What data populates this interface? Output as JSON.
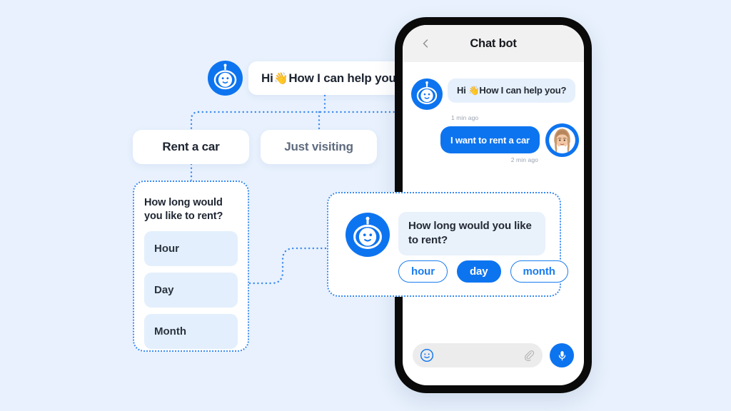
{
  "theme": {
    "background": "#e8f1fd",
    "accent_blue": "#0d74f0",
    "dotted_line": "#3b8af0",
    "bubble_light": "#e6f0fc",
    "panel_item": "#e3effc",
    "phone_frame": "#0a0a0a",
    "header_bg": "#f1f1f1",
    "muted_text": "#9aa3b0"
  },
  "flow": {
    "bot_icon": "chat-bot-icon",
    "greeting": {
      "prefix": "Hi ",
      "emoji": "👋",
      "text": "How I can help you?"
    },
    "options": [
      {
        "label": "Rent a car",
        "state": "selected"
      },
      {
        "label": "Just visiting",
        "state": "default"
      }
    ],
    "rent_panel": {
      "title": "How long would you like to rent?",
      "items": [
        "Hour",
        "Day",
        "Month"
      ]
    },
    "answer_card": {
      "bot_icon": "chat-bot-icon",
      "question": "How long would you like to rent?",
      "chips": [
        {
          "label": "hour",
          "style": "outline"
        },
        {
          "label": "day",
          "style": "filled"
        },
        {
          "label": "month",
          "style": "outline"
        }
      ]
    }
  },
  "phone": {
    "header": {
      "back_icon": "chevron-left-icon",
      "title": "Chat bot"
    },
    "messages": [
      {
        "sender": "bot",
        "avatar": "chat-bot-icon",
        "prefix": "Hi ",
        "emoji": "👋",
        "text": "How I can help you?",
        "timestamp": "1 min ago"
      },
      {
        "sender": "user",
        "avatar": "user-avatar-woman",
        "text": "I want to rent a car",
        "timestamp": "2 min ago"
      }
    ],
    "input_bar": {
      "emoji_icon": "smiley-face-icon",
      "attach_icon": "paperclip-icon",
      "mic_icon": "microphone-icon",
      "placeholder": ""
    }
  }
}
